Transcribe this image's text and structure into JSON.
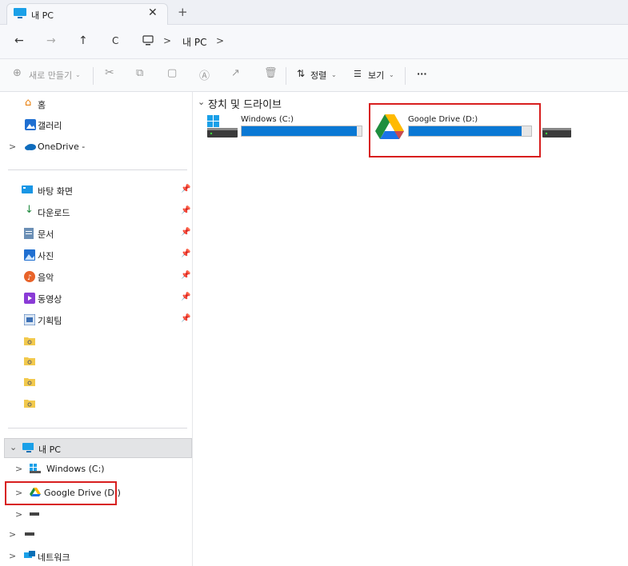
{
  "tab": {
    "title": "내 PC",
    "close": "✕",
    "add": "+"
  },
  "nav": {
    "back": "←",
    "forward": "→",
    "up": "↑",
    "refresh": "C",
    "breadcrumb": [
      {
        "label": "내 PC"
      }
    ],
    "sep": ">"
  },
  "toolbar": {
    "new_label": "새로 만들기",
    "sort_label": "정렬",
    "view_label": "보기",
    "more": "···"
  },
  "sidebar": {
    "home": "홈",
    "gallery": "갤러리",
    "onedrive": "OneDrive -",
    "quick": [
      {
        "label": "바탕 화면"
      },
      {
        "label": "다운로드"
      },
      {
        "label": "문서"
      },
      {
        "label": "사진"
      },
      {
        "label": "음악"
      },
      {
        "label": "동영상"
      },
      {
        "label": "기획팀"
      }
    ],
    "this_pc": "내 PC",
    "c_drive": "Windows (C:)",
    "d_drive": "Google Drive (D:)",
    "network": "네트워크"
  },
  "main": {
    "section": "장치 및 드라이브",
    "drives": [
      {
        "name": "Windows (C:)",
        "usage": 0.96
      },
      {
        "name": "Google Drive (D:)",
        "usage": 0.92
      }
    ]
  },
  "colors": {
    "accent": "#0a78d4",
    "highlight": "#d81e1e",
    "selected": "#e3e4e6"
  }
}
